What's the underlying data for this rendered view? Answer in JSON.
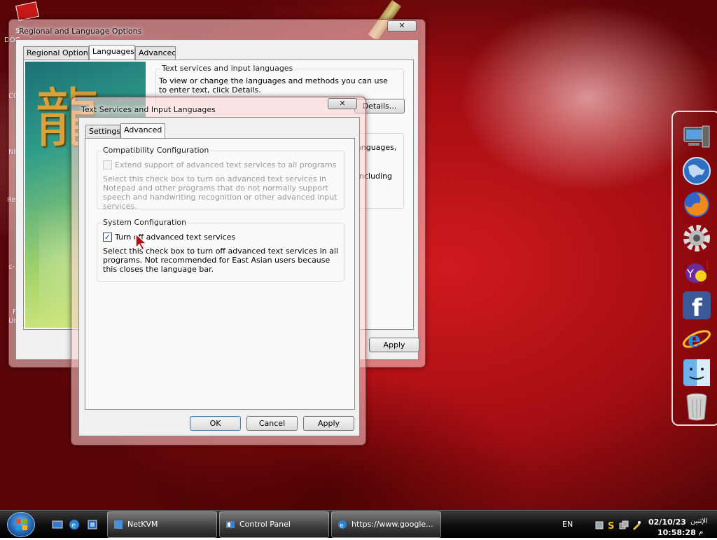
{
  "desktop": {
    "icons": [
      "S",
      "DOC",
      "CO",
      "NE",
      "Re",
      "c-",
      "F",
      "Ur"
    ]
  },
  "regional_window": {
    "title": "Regional and Language Options",
    "close_label": "✕",
    "tabs": [
      "Regional Options",
      "Languages",
      "Advanced"
    ],
    "active_tab": "Languages",
    "text_services_group": "Text services and input languages",
    "text_services_desc": "To view or change the languages and methods you can use to enter text, click Details.",
    "details_button": "Details...",
    "partial_text_1": "anguages,",
    "partial_text_2": "ncluding",
    "apply_button": "Apply"
  },
  "tsi_window": {
    "title": "Text Services and Input Languages",
    "close_label": "✕",
    "tabs": [
      "Settings",
      "Advanced"
    ],
    "active_tab": "Advanced",
    "compat_group": "Compatibility Configuration",
    "compat_checkbox_label": "Extend support of advanced text services to all programs",
    "compat_checked": false,
    "compat_desc": "Select this check box to turn on advanced text services in Notepad and other programs that do not normally support speech and handwriting recognition or other advanced input services.",
    "system_group": "System Configuration",
    "system_checkbox_label": "Turn off advanced text services",
    "system_checked": true,
    "system_checkbox_mark": "✓",
    "system_desc": "Select this check box to turn off advanced text services in all programs. Not recommended for East Asian users because this closes the language bar.",
    "ok_button": "OK",
    "cancel_button": "Cancel",
    "apply_button": "Apply"
  },
  "dock": {
    "icons": [
      "computer-icon",
      "globe-icon",
      "firefox-icon",
      "settings-gear-icon",
      "yahoo-messenger-icon",
      "facebook-icon",
      "internet-explorer-icon",
      "finder-icon",
      "trash-icon"
    ]
  },
  "taskbar": {
    "tasks": [
      "NetKVM",
      "Control Panel",
      "https://www.google..."
    ],
    "language": "EN",
    "day": "الإثنين",
    "date": "02/10/23",
    "time": "10:58:28",
    "ampm": "م"
  },
  "colors": {
    "wallpaper_red": "#c0141a",
    "accent_blue": "#3c7fb1"
  }
}
